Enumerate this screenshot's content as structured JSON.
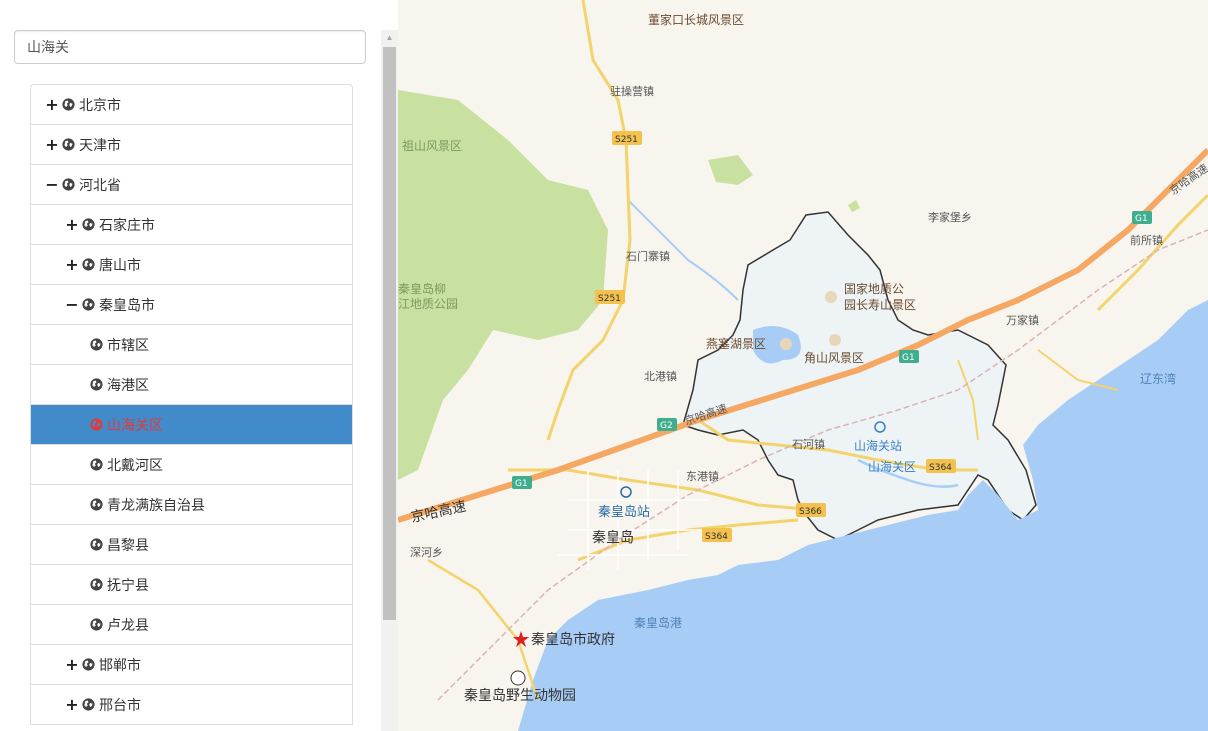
{
  "search": {
    "value": "山海关"
  },
  "tree": {
    "nodes": [
      {
        "label": "北京市",
        "toggle": "+"
      },
      {
        "label": "天津市",
        "toggle": "+"
      },
      {
        "label": "河北省",
        "toggle": "−"
      },
      {
        "label": "石家庄市",
        "toggle": "+"
      },
      {
        "label": "唐山市",
        "toggle": "+"
      },
      {
        "label": "秦皇岛市",
        "toggle": "−"
      },
      {
        "label": "市辖区"
      },
      {
        "label": "海港区"
      },
      {
        "label": "山海关区",
        "selected": true
      },
      {
        "label": "北戴河区"
      },
      {
        "label": "青龙满族自治县"
      },
      {
        "label": "昌黎县"
      },
      {
        "label": "抚宁县"
      },
      {
        "label": "卢龙县"
      },
      {
        "label": "邯郸市",
        "toggle": "+"
      },
      {
        "label": "邢台市",
        "toggle": "+"
      }
    ]
  },
  "map": {
    "labels": {
      "dongjiakou": "董家口长城风景区",
      "zhucaoying": "驻操营镇",
      "s251_a": "S251",
      "s251_b": "S251",
      "zushan": "祖山风景区",
      "lijiabao": "李家堡乡",
      "g1_ne": "G1",
      "qiansuo": "前所镇",
      "jingha_ne": "京哈高速",
      "shimenzhai": "石门寨镇",
      "liuzhuang_1": "秦皇岛柳",
      "liuzhuang_2": "江地质公园",
      "geopark_1": "国家地质公",
      "geopark_2": "园长寿山景区",
      "yanse": "燕塞湖景区",
      "jiaoshan": "角山风景区",
      "g1_mid": "G1",
      "wanjia": "万家镇",
      "liaodong": "辽东湾",
      "beigang": "北港镇",
      "g2_shield": "G2",
      "jingha_mid": "京哈高速",
      "shihe": "石河镇",
      "shanhaiguan_station": "山海关站",
      "shanhaiguan_district": "山海关区",
      "s364_a": "S364",
      "donggang": "东港镇",
      "g1_w": "G1",
      "jingha_w": "京哈高速",
      "qhd_station": "秦皇岛站",
      "s366": "S366",
      "qhd_city": "秦皇岛",
      "s364_b": "S364",
      "shenhe": "深河乡",
      "qhd_port": "秦皇岛港",
      "gov": "秦皇岛市政府",
      "zoo": "秦皇岛野生动物园"
    }
  },
  "colors": {
    "selected_bg": "#428bca",
    "selected_text": "#e03a3a",
    "sea": "#a7cdf6",
    "land": "#f8f5ef",
    "green": "#c9e1a0",
    "highway": "#f4a863",
    "district_fill": "#eef4f6"
  }
}
